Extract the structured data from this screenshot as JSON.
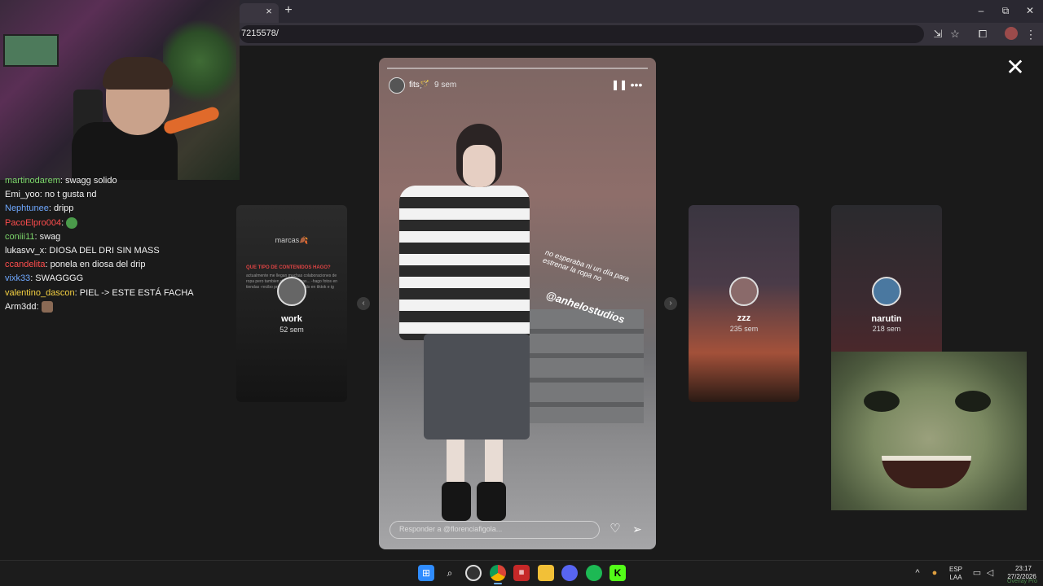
{
  "browser": {
    "tab_close": "×",
    "tab_new": "+",
    "url": "7215578/",
    "window_controls": {
      "minimize": "–",
      "restore": "⧉",
      "close": "✕"
    },
    "toolbar_icons": [
      "install-icon",
      "star-icon",
      "extensions-icon"
    ]
  },
  "story_viewer": {
    "close_symbol": "✕",
    "main_story": {
      "username": "fits🪄",
      "time": "9 sem",
      "sticker_text": "no esperaba ni un día para estrenar la ropa no",
      "mention": "@anhelostudios",
      "reply_placeholder": "Responder a @florenciafigola...",
      "pause_symbol": "❚❚",
      "more_symbol": "•••"
    },
    "left_card": {
      "title": "marcas🍂",
      "section": "QUE TIPO DE CONTENIDOS HAGO?",
      "body": "actualmente me llegan muchas colaboraciones de ropa pero tambien de otras cosas... -hago fotos en tiendas -recibo producto -contenido en tiktok e ig",
      "name": "work",
      "time": "52 sem"
    },
    "right_cards": [
      {
        "name": "zzz",
        "time": "235 sem"
      },
      {
        "name": "narutin",
        "time": "218 sem"
      }
    ],
    "prev_arrow": "‹",
    "next_arrow": "›"
  },
  "chat": {
    "messages": [
      {
        "user": "martinodarem",
        "text": ": swagg solido",
        "color": "#7cd66a"
      },
      {
        "user": "Emi_yoo",
        "text": ": no t gusta nd",
        "color": "#f2f2f2"
      },
      {
        "user": "Nephtunee",
        "text": ": dripp",
        "color": "#6fa8ff"
      },
      {
        "user": "PacoElpro004",
        "text": ": ",
        "color": "#ff4d4d",
        "emote": true
      },
      {
        "user": "coniii11",
        "text": ": swag",
        "color": "#7cd66a"
      },
      {
        "user": "lukasvv_x",
        "text": ": DIOSA DEL DRI SIN MASS",
        "color": "#f2f2f2"
      },
      {
        "user": "ccandelita",
        "text": ": ponela en diosa del drip",
        "color": "#ff4d4d"
      },
      {
        "user": "vixk33",
        "text": ": SWAGGGG",
        "color": "#6fa8ff"
      },
      {
        "user": "valentino_dascon",
        "text": ": PIEL -> ESTE ESTÁ FACHA",
        "color": "#f5d142"
      },
      {
        "user": "Arm3dd",
        "text": ": ",
        "color": "#f2f2f2",
        "emote": true
      }
    ]
  },
  "taskbar": {
    "icons": [
      "windows-start-icon",
      "search-icon",
      "obs-icon",
      "chrome-icon",
      "calendar-icon",
      "file-explorer-icon",
      "discord-icon",
      "spotify-icon",
      "kick-icon"
    ],
    "tray_lang_1": "ESP",
    "tray_lang_2": "LAA",
    "time": "23:17",
    "date": "27/2/2026",
    "chevron": "^"
  },
  "watermark": "Overlay Pro",
  "colors": {
    "taskbar_bg": "#1c1c1c",
    "viewer_bg": "#1a1a1a",
    "accent_blue": "#6fb2ff"
  }
}
